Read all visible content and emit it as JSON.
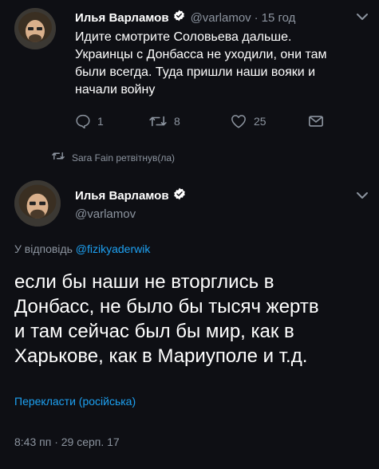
{
  "top_tweet": {
    "author_name": "Илья Варламов",
    "handle": "@varlamov",
    "separator": "·",
    "time": "15 год",
    "text_lines": [
      "Идите смотрите Соловьева дальше.",
      "Украинцы с Донбасса не уходили, они там",
      "были всегда. Туда пришли наши вояки и",
      "начали войну"
    ],
    "reply_count": "1",
    "retweet_count": "8",
    "like_count": "25"
  },
  "retweet_notice": "Sara Fain ретвітнув(ла)",
  "main_tweet": {
    "author_name": "Илья Варламов",
    "handle": "@varlamov",
    "reply_prefix": "У відповідь",
    "reply_to": "@fizikyaderwik",
    "text_lines": [
      "если бы наши не вторглись в",
      "Донбасс, не было бы тысяч жертв",
      "и там сейчас был бы мир, как в",
      "Харькове, как в Мариуполе и т.д."
    ],
    "translate_label": "Перекласти (російська)",
    "timestamp": "8:43 пп · 29 серп. 17"
  },
  "colors": {
    "background": "#0e0f14",
    "muted": "#8c949f",
    "link": "#1da1f2",
    "verified_badge": "#ffffff"
  },
  "icons": [
    "reply-icon",
    "retweet-icon",
    "like-icon",
    "share-icon",
    "verified-icon",
    "chevron-down-icon"
  ]
}
